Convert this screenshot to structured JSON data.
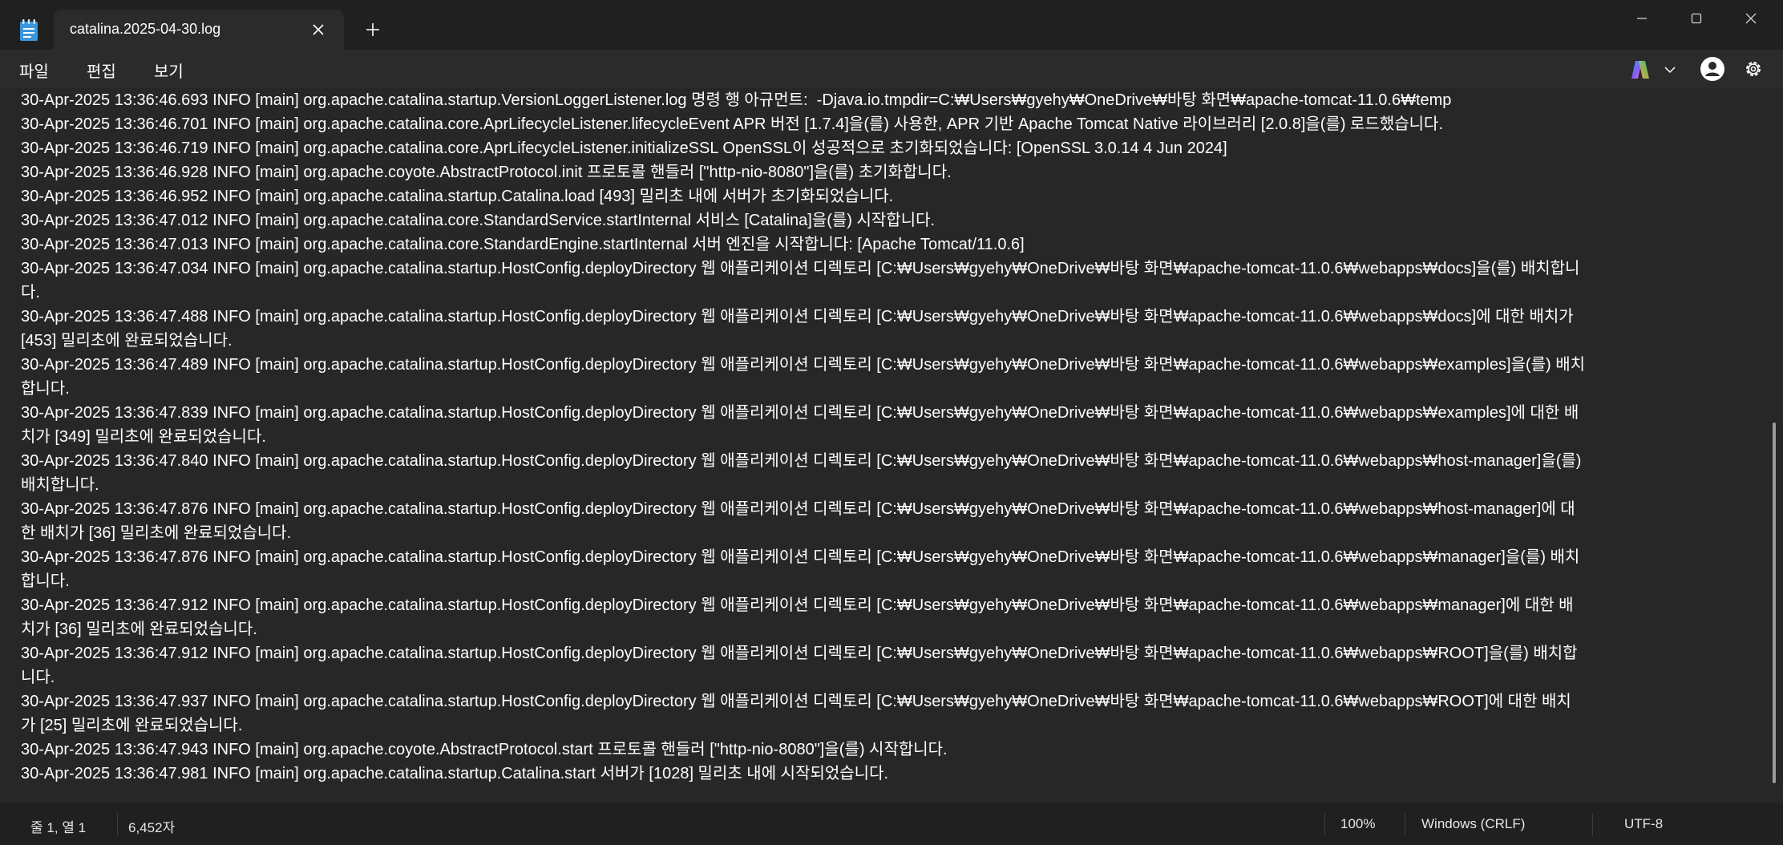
{
  "window": {
    "tab_title": "catalina.2025-04-30.log",
    "icons": [
      "notepad-icon",
      "close-icon",
      "plus-icon",
      "minimize-icon",
      "maximize-icon",
      "close-window-icon"
    ]
  },
  "menu": {
    "file": "파일",
    "edit": "편집",
    "view": "보기",
    "right_icons": [
      "copilot-icon",
      "chevron-down-icon",
      "account-icon",
      "gear-icon"
    ]
  },
  "log_lines": [
    "30-Apr-2025 13:36:46.693 INFO [main] org.apache.catalina.startup.VersionLoggerListener.log 명령 행 아규먼트:  -Djava.io.tmpdir=C:₩Users₩gyehy₩OneDrive₩바탕 화면₩apache-tomcat-11.0.6₩temp",
    "30-Apr-2025 13:36:46.701 INFO [main] org.apache.catalina.core.AprLifecycleListener.lifecycleEvent APR 버전 [1.7.4]을(를) 사용한, APR 기반 Apache Tomcat Native 라이브러리 [2.0.8]을(를) 로드했습니다.",
    "30-Apr-2025 13:36:46.719 INFO [main] org.apache.catalina.core.AprLifecycleListener.initializeSSL OpenSSL이 성공적으로 초기화되었습니다: [OpenSSL 3.0.14 4 Jun 2024]",
    "30-Apr-2025 13:36:46.928 INFO [main] org.apache.coyote.AbstractProtocol.init 프로토콜 핸들러 [\"http-nio-8080\"]을(를) 초기화합니다.",
    "30-Apr-2025 13:36:46.952 INFO [main] org.apache.catalina.startup.Catalina.load [493] 밀리초 내에 서버가 초기화되었습니다.",
    "30-Apr-2025 13:36:47.012 INFO [main] org.apache.catalina.core.StandardService.startInternal 서비스 [Catalina]을(를) 시작합니다.",
    "30-Apr-2025 13:36:47.013 INFO [main] org.apache.catalina.core.StandardEngine.startInternal 서버 엔진을 시작합니다: [Apache Tomcat/11.0.6]",
    "30-Apr-2025 13:36:47.034 INFO [main] org.apache.catalina.startup.HostConfig.deployDirectory 웹 애플리케이션 디렉토리 [C:₩Users₩gyehy₩OneDrive₩바탕 화면₩apache-tomcat-11.0.6₩webapps₩docs]을(를) 배치합니\n다.",
    "30-Apr-2025 13:36:47.488 INFO [main] org.apache.catalina.startup.HostConfig.deployDirectory 웹 애플리케이션 디렉토리 [C:₩Users₩gyehy₩OneDrive₩바탕 화면₩apache-tomcat-11.0.6₩webapps₩docs]에 대한 배치가\n[453] 밀리초에 완료되었습니다.",
    "30-Apr-2025 13:36:47.489 INFO [main] org.apache.catalina.startup.HostConfig.deployDirectory 웹 애플리케이션 디렉토리 [C:₩Users₩gyehy₩OneDrive₩바탕 화면₩apache-tomcat-11.0.6₩webapps₩examples]을(를) 배치\n합니다.",
    "30-Apr-2025 13:36:47.839 INFO [main] org.apache.catalina.startup.HostConfig.deployDirectory 웹 애플리케이션 디렉토리 [C:₩Users₩gyehy₩OneDrive₩바탕 화면₩apache-tomcat-11.0.6₩webapps₩examples]에 대한 배\n치가 [349] 밀리초에 완료되었습니다.",
    "30-Apr-2025 13:36:47.840 INFO [main] org.apache.catalina.startup.HostConfig.deployDirectory 웹 애플리케이션 디렉토리 [C:₩Users₩gyehy₩OneDrive₩바탕 화면₩apache-tomcat-11.0.6₩webapps₩host-manager]을(를)\n배치합니다.",
    "30-Apr-2025 13:36:47.876 INFO [main] org.apache.catalina.startup.HostConfig.deployDirectory 웹 애플리케이션 디렉토리 [C:₩Users₩gyehy₩OneDrive₩바탕 화면₩apache-tomcat-11.0.6₩webapps₩host-manager]에 대\n한 배치가 [36] 밀리초에 완료되었습니다.",
    "30-Apr-2025 13:36:47.876 INFO [main] org.apache.catalina.startup.HostConfig.deployDirectory 웹 애플리케이션 디렉토리 [C:₩Users₩gyehy₩OneDrive₩바탕 화면₩apache-tomcat-11.0.6₩webapps₩manager]을(를) 배치\n합니다.",
    "30-Apr-2025 13:36:47.912 INFO [main] org.apache.catalina.startup.HostConfig.deployDirectory 웹 애플리케이션 디렉토리 [C:₩Users₩gyehy₩OneDrive₩바탕 화면₩apache-tomcat-11.0.6₩webapps₩manager]에 대한 배\n치가 [36] 밀리초에 완료되었습니다.",
    "30-Apr-2025 13:36:47.912 INFO [main] org.apache.catalina.startup.HostConfig.deployDirectory 웹 애플리케이션 디렉토리 [C:₩Users₩gyehy₩OneDrive₩바탕 화면₩apache-tomcat-11.0.6₩webapps₩ROOT]을(를) 배치합\n니다.",
    "30-Apr-2025 13:36:47.937 INFO [main] org.apache.catalina.startup.HostConfig.deployDirectory 웹 애플리케이션 디렉토리 [C:₩Users₩gyehy₩OneDrive₩바탕 화면₩apache-tomcat-11.0.6₩webapps₩ROOT]에 대한 배치\n가 [25] 밀리초에 완료되었습니다.",
    "30-Apr-2025 13:36:47.943 INFO [main] org.apache.coyote.AbstractProtocol.start 프로토콜 핸들러 [\"http-nio-8080\"]을(를) 시작합니다.",
    "30-Apr-2025 13:36:47.981 INFO [main] org.apache.catalina.startup.Catalina.start 서버가 [1028] 밀리초 내에 시작되었습니다."
  ],
  "status": {
    "position": "줄 1, 열 1",
    "char_count": "6,452자",
    "zoom": "100%",
    "line_ending": "Windows (CRLF)",
    "encoding": "UTF-8"
  }
}
